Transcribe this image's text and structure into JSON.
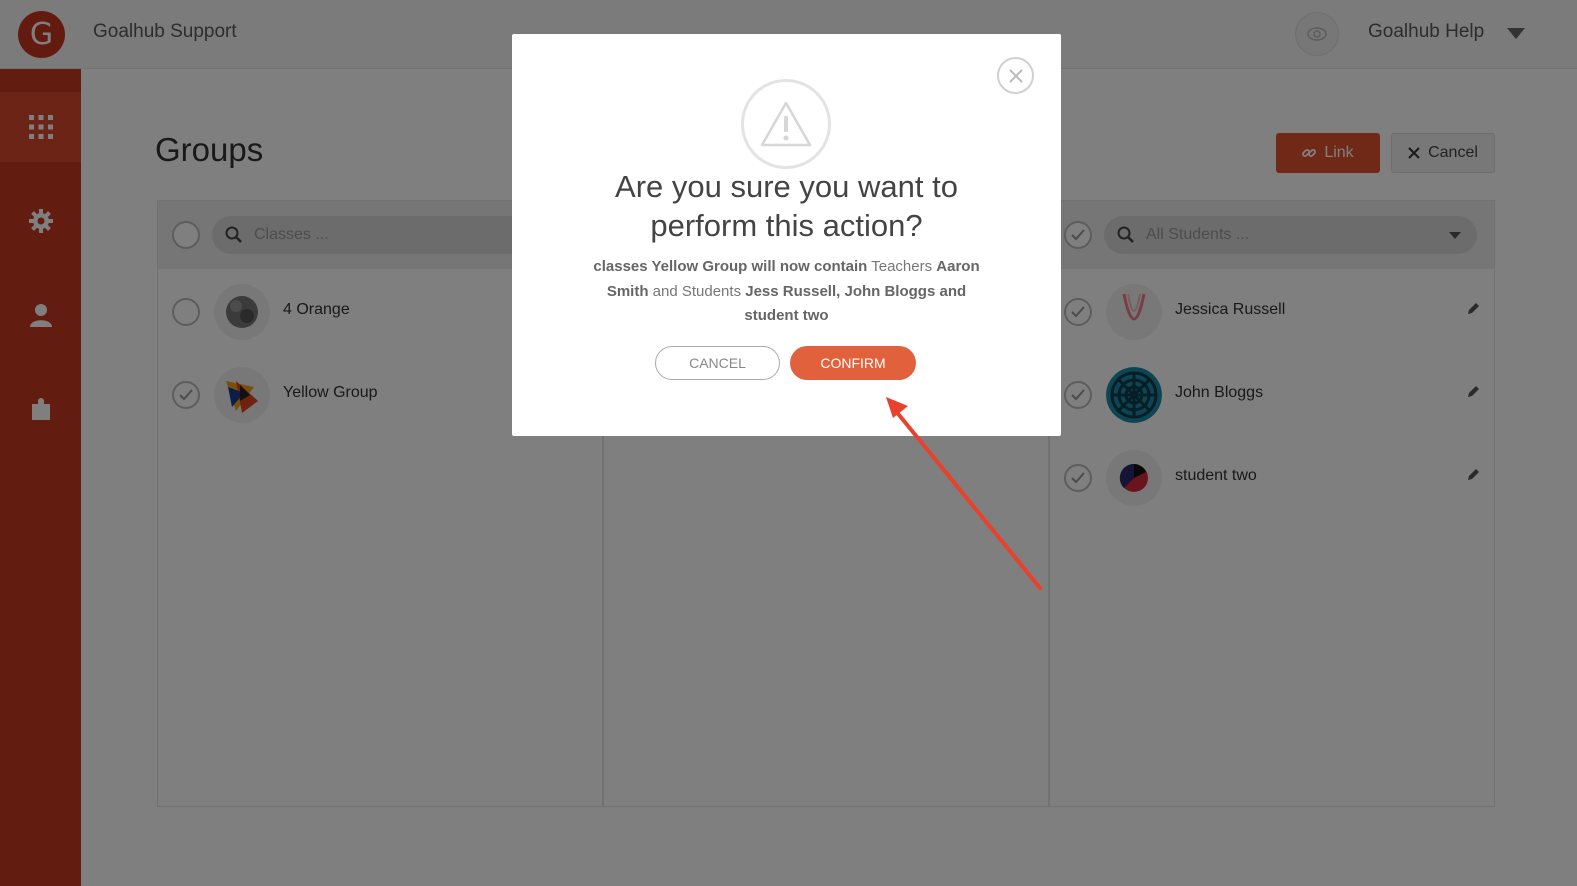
{
  "topbar": {
    "logo_letter": "G",
    "app_title": "Goalhub Support",
    "help_label": "Goalhub Help"
  },
  "sidebar": {
    "items": [
      {
        "icon": "grid-icon",
        "active": true
      },
      {
        "icon": "gear-icon",
        "active": false
      },
      {
        "icon": "user-icon",
        "active": false
      },
      {
        "icon": "puzzle-icon",
        "active": false
      }
    ]
  },
  "page": {
    "title": "Groups",
    "link_button": "Link",
    "cancel_button": "Cancel"
  },
  "classes_panel": {
    "search_placeholder": "Classes ...",
    "rows": [
      {
        "name": "4 Orange",
        "checked": false
      },
      {
        "name": "Yellow Group",
        "checked": true
      }
    ]
  },
  "students_panel": {
    "search_placeholder": "All Students ...",
    "rows": [
      {
        "name": "Jessica Russell",
        "checked": true
      },
      {
        "name": "John Bloggs",
        "checked": true
      },
      {
        "name": "student two",
        "checked": true
      }
    ]
  },
  "modal": {
    "title": "Are you sure you want to perform this action?",
    "body_1": "classes Yellow Group will now contain",
    "body_2": " Teachers ",
    "body_3": "Aaron Smith",
    "body_4": " and Students ",
    "body_5": "Jess Russell, John Bloggs and student two",
    "cancel_label": "CANCEL",
    "confirm_label": "CONFIRM"
  },
  "colors": {
    "brand": "#c53a20",
    "accent": "#e0613b",
    "annotation": "#e8412c"
  }
}
